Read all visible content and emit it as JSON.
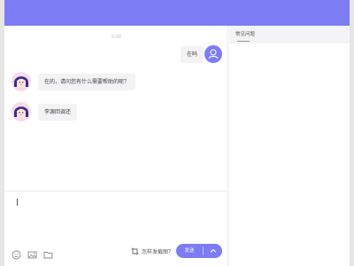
{
  "chat": {
    "timestamp": "9:00",
    "messages": [
      {
        "from": "user",
        "text": "在吗"
      },
      {
        "from": "bot",
        "text": "在的，请问您有什么需要帮助的呢？"
      },
      {
        "from": "bot",
        "text": "李源回调还"
      }
    ]
  },
  "input": {
    "value": "",
    "tools": [
      "emoji-icon",
      "image-icon",
      "folder-icon"
    ],
    "screenshot_help_label": "怎样发截图？",
    "send_label": "发送"
  },
  "sidebar": {
    "tabs": [
      {
        "label": "常见问题"
      }
    ]
  },
  "colors": {
    "accent": "#7c7cf5",
    "bubble": "#f3f3f6",
    "background": "#e6e6e6"
  }
}
